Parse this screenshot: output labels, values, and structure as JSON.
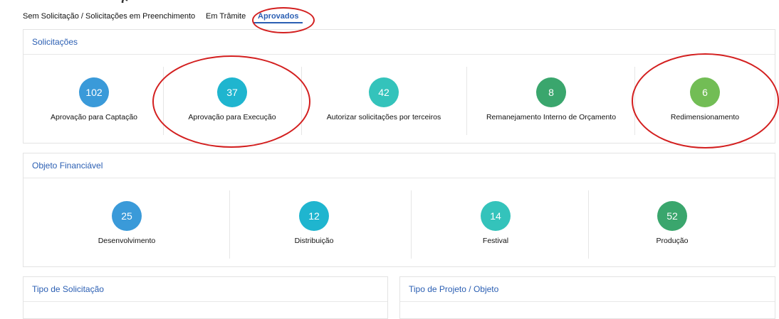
{
  "tabs": [
    {
      "label": "Sem Solicitação / Solicitações em Preenchimento"
    },
    {
      "label": "Em Trâmite"
    },
    {
      "label": "Aprovados"
    }
  ],
  "solicitacoes": {
    "title": "Solicitações",
    "items": [
      {
        "value": "102",
        "label": "Aprovação para Captação",
        "color": "#3a9ad9"
      },
      {
        "value": "37",
        "label": "Aprovação para Execução",
        "color": "#1fb5cf"
      },
      {
        "value": "42",
        "label": "Autorizar solicitações por terceiros",
        "color": "#34c3bb"
      },
      {
        "value": "8",
        "label": "Remanejamento Interno de Orçamento",
        "color": "#3aa66d"
      },
      {
        "value": "6",
        "label": "Redimensionamento",
        "color": "#72bd55"
      }
    ]
  },
  "objeto": {
    "title": "Objeto Financiável",
    "items": [
      {
        "value": "25",
        "label": "Desenvolvimento",
        "color": "#3a9ad9"
      },
      {
        "value": "12",
        "label": "Distribuição",
        "color": "#1fb5cf"
      },
      {
        "value": "14",
        "label": "Festival",
        "color": "#34c3bb"
      },
      {
        "value": "52",
        "label": "Produção",
        "color": "#3aa66d"
      }
    ]
  },
  "tipo_solicitacao": {
    "title": "Tipo de Solicitação"
  },
  "tipo_projeto": {
    "title": "Tipo de Projeto / Objeto"
  },
  "annotations": {
    "color": "#d31f1f"
  }
}
